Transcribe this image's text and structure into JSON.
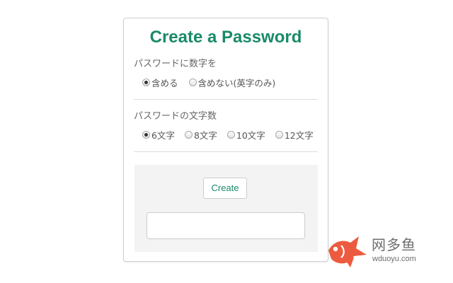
{
  "title": "Create a Password",
  "colors": {
    "accent": "#1a8a6a",
    "watermark_fish": "#ec5b3f"
  },
  "digits_section": {
    "label": "パスワードに数字を",
    "options": [
      {
        "label": "含める",
        "selected": true
      },
      {
        "label": "含めない(英字のみ)",
        "selected": false
      }
    ]
  },
  "length_section": {
    "label": "パスワードの文字数",
    "options": [
      {
        "label": "6文字",
        "selected": true
      },
      {
        "label": "8文字",
        "selected": false
      },
      {
        "label": "10文字",
        "selected": false
      },
      {
        "label": "12文字",
        "selected": false
      }
    ]
  },
  "actions": {
    "create_label": "Create",
    "output_value": ""
  },
  "watermark": {
    "brand": "网多鱼",
    "domain": "wduoyu.com",
    "icon": "fish-logo-icon"
  }
}
